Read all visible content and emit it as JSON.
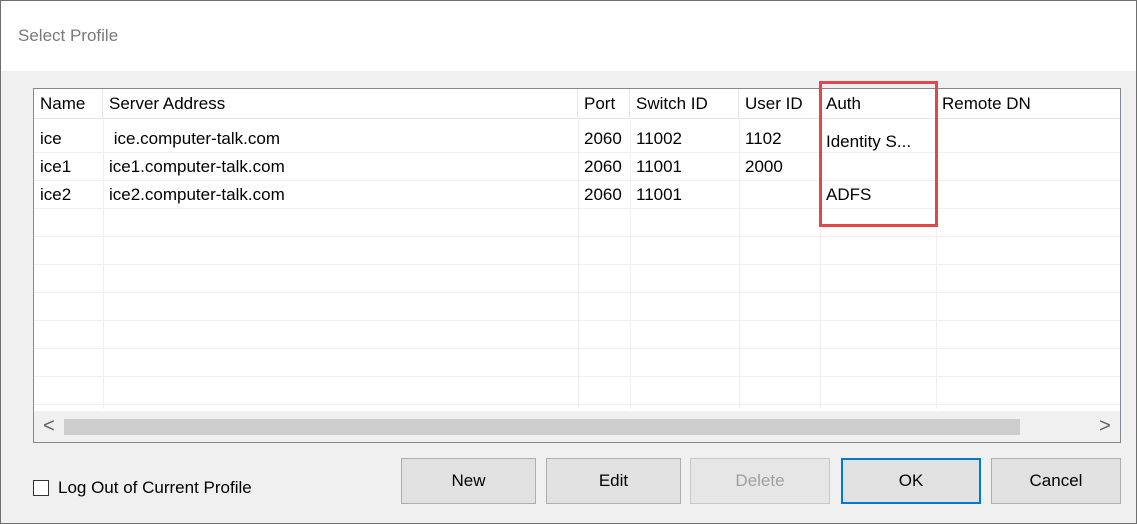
{
  "window": {
    "title": "Select Profile"
  },
  "table": {
    "columns": [
      "Name",
      "Server Address",
      "Port",
      "Switch ID",
      "User ID",
      "Auth",
      "Remote DN"
    ],
    "rows": [
      {
        "name": "ice",
        "server": " ice.computer-talk.com",
        "port": "2060",
        "switch_id": "11002",
        "user_id": "1102",
        "auth": "Identity S...",
        "remote_dn": ""
      },
      {
        "name": "ice1",
        "server": "ice1.computer-talk.com",
        "port": "2060",
        "switch_id": "11001",
        "user_id": "2000",
        "auth": "",
        "remote_dn": ""
      },
      {
        "name": "ice2",
        "server": "ice2.computer-talk.com",
        "port": "2060",
        "switch_id": "11001",
        "user_id": "",
        "auth": "ADFS",
        "remote_dn": ""
      }
    ]
  },
  "scrollbar": {
    "left_arrow": "<",
    "right_arrow": ">"
  },
  "footer": {
    "logout_label": "Log Out of Current Profile",
    "buttons": {
      "new": "New",
      "edit": "Edit",
      "delete": "Delete",
      "ok": "OK",
      "cancel": "Cancel"
    }
  },
  "colors": {
    "highlight": "#e2484a",
    "accent": "#0078d7"
  }
}
